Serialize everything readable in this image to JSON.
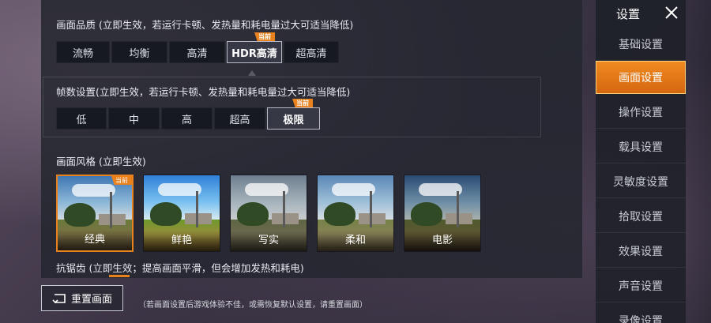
{
  "quality": {
    "title": "画面品质 (立即生效，若运行卡顿、发热量和耗电量过大可适当降低)",
    "options": [
      "流畅",
      "均衡",
      "高清",
      "HDR高清",
      "超高清"
    ],
    "selected_index": 3,
    "current_badge": "当前"
  },
  "fps": {
    "title": "帧数设置(立即生效，若运行卡顿、发热量和耗电量过大可适当降低)",
    "options": [
      "低",
      "中",
      "高",
      "超高",
      "极限"
    ],
    "selected_index": 4,
    "current_badge": "当前"
  },
  "style": {
    "title": "画面风格 (立即生效)",
    "items": [
      {
        "label": "经典",
        "badge": "当前"
      },
      {
        "label": "鲜艳"
      },
      {
        "label": "写实"
      },
      {
        "label": "柔和"
      },
      {
        "label": "电影"
      }
    ]
  },
  "anti_alias": {
    "title": "抗锯齿 (立即生效；提高画面平滑，但会增加发热和耗电)"
  },
  "reset": {
    "label": "重置画面",
    "hint": "（若画面设置后游戏体验不佳，或需恢复默认设置，请重置画面）"
  },
  "sidebar": {
    "title": "设置",
    "items": [
      {
        "label": "基础设置"
      },
      {
        "label": "画面设置",
        "active": true
      },
      {
        "label": "操作设置"
      },
      {
        "label": "载具设置"
      },
      {
        "label": "灵敏度设置"
      },
      {
        "label": "拾取设置"
      },
      {
        "label": "效果设置"
      },
      {
        "label": "声音设置"
      },
      {
        "label": "录像设置"
      }
    ]
  },
  "colors": {
    "accent": "#e8811e",
    "panel": "#24262f",
    "text": "#e6e8ec"
  },
  "icons": {
    "close": "close-icon",
    "reset": "reset-icon"
  }
}
